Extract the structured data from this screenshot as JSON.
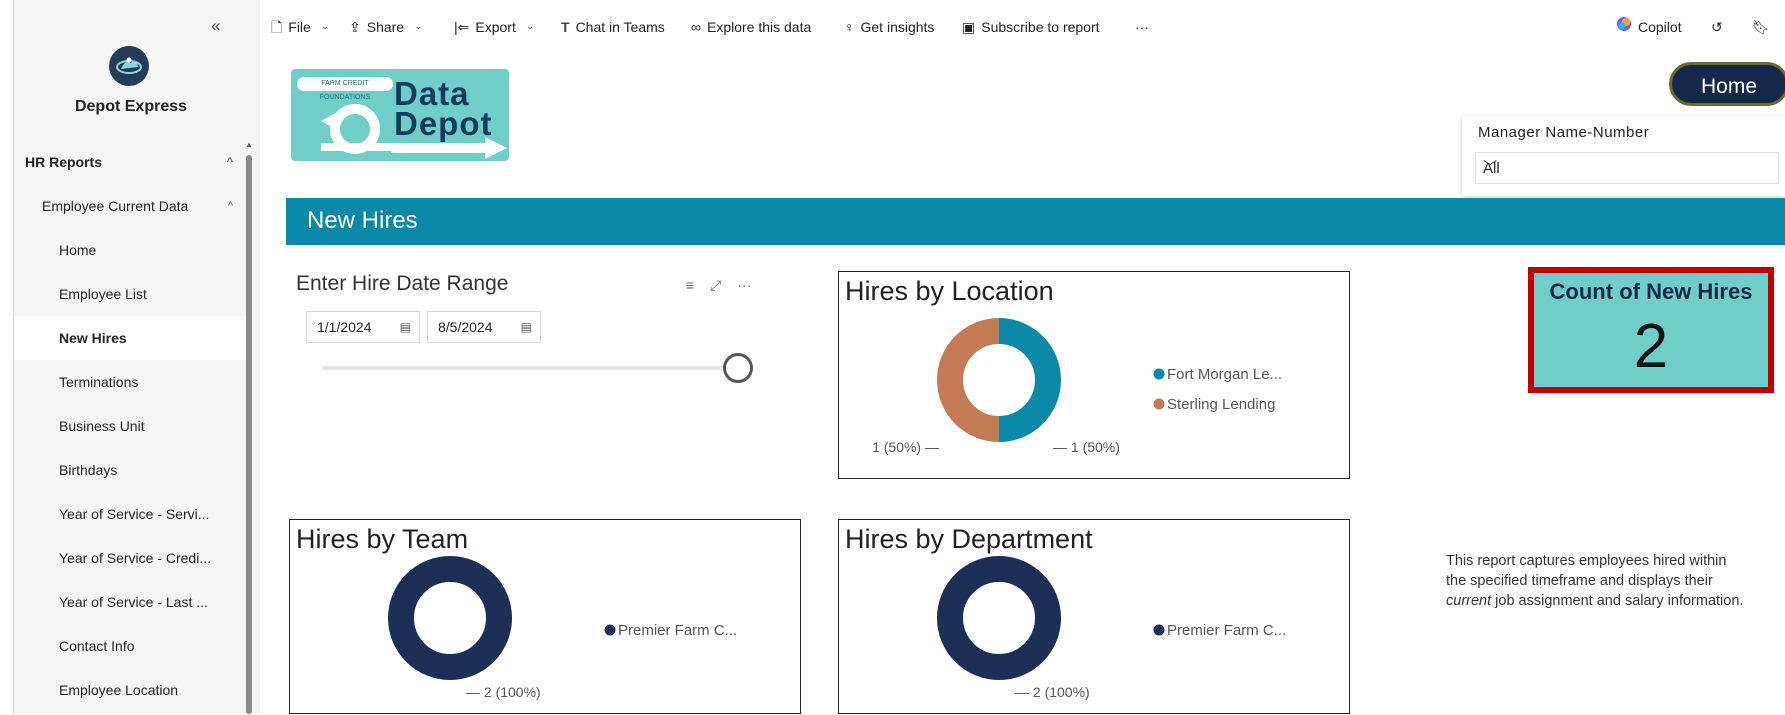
{
  "sidebar": {
    "app_name": "Depot Express",
    "collapse_glyph": "«",
    "items": [
      {
        "label": "HR Reports",
        "level": 0,
        "chevron": "^"
      },
      {
        "label": "Employee Current Data",
        "level": 1,
        "chevron": "^"
      },
      {
        "label": "Home",
        "level": 2
      },
      {
        "label": "Employee List",
        "level": 2
      },
      {
        "label": "New Hires",
        "level": 2,
        "active": true
      },
      {
        "label": "Terminations",
        "level": 2
      },
      {
        "label": "Business Unit",
        "level": 2
      },
      {
        "label": "Birthdays",
        "level": 2
      },
      {
        "label": "Year of Service - Servi...",
        "level": 2
      },
      {
        "label": "Year of Service - Credi...",
        "level": 2
      },
      {
        "label": "Year of Service - Last ...",
        "level": 2
      },
      {
        "label": "Contact Info",
        "level": 2
      },
      {
        "label": "Employee Location",
        "level": 2
      }
    ]
  },
  "toolbar": {
    "file": "File",
    "share": "Share",
    "export": "Export",
    "chat_in_teams": "Chat in Teams",
    "explore": "Explore this data",
    "insights": "Get insights",
    "subscribe": "Subscribe to report",
    "more": "···",
    "copilot": "Copilot"
  },
  "report": {
    "logo_line1": "Data",
    "logo_line2": "Depot",
    "logo_badge": "FARM CREDIT FOUNDATIONS",
    "home_button": "Home",
    "manager_slicer": {
      "title": "Manager Name-Number",
      "value": "All"
    },
    "banner_title": "New Hires",
    "date_slicer": {
      "title": "Enter Hire Date Range",
      "start": "1/1/2024",
      "end": "8/5/2024"
    },
    "count_card": {
      "label": "Count of New Hires",
      "value": "2"
    },
    "description_pre": "This report captures employees hired within the specified timeframe and displays their ",
    "description_em": "current",
    "description_post": " job assignment and salary information."
  },
  "colors": {
    "teal": "#0a88a8",
    "sienna": "#c47a55",
    "navy": "#1c2f57",
    "card_bg": "#6fcfc8",
    "card_border": "#c00000"
  },
  "chart_data": [
    {
      "type": "pie",
      "title": "Hires by Location",
      "categories": [
        "Fort Morgan Le...",
        "Sterling Lending"
      ],
      "values": [
        1,
        1
      ],
      "data_labels": [
        "1 (50%)",
        "1 (50%)"
      ]
    },
    {
      "type": "pie",
      "title": "Hires by Team",
      "categories": [
        "Premier Farm C..."
      ],
      "values": [
        2
      ],
      "data_labels": [
        "2 (100%)"
      ]
    },
    {
      "type": "pie",
      "title": "Hires by Department",
      "categories": [
        "Premier Farm C..."
      ],
      "values": [
        2
      ],
      "data_labels": [
        "2 (100%)"
      ]
    }
  ]
}
